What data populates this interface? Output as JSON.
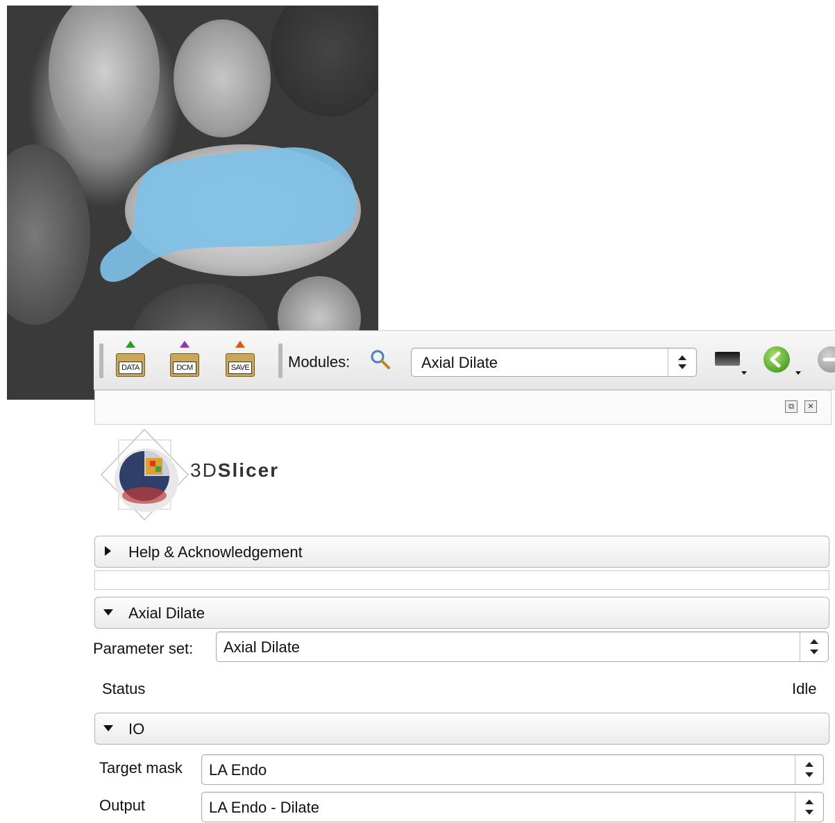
{
  "toolbar": {
    "data_label": "DATA",
    "dcm_label": "DCM",
    "save_label": "SAVE",
    "modules_label": "Modules:",
    "module_selected": "Axial Dilate"
  },
  "logo": {
    "text_prefix": "3D",
    "text_main": "Slicer"
  },
  "sections": {
    "help": "Help & Acknowledgement",
    "axial_dilate": "Axial Dilate",
    "io": "IO"
  },
  "parameter_set": {
    "label": "Parameter set:",
    "value": "Axial Dilate"
  },
  "status": {
    "label": "Status",
    "value": "Idle"
  },
  "io": {
    "target_mask_label": "Target mask",
    "target_mask_value": "LA Endo",
    "output_label": "Output",
    "output_value": "LA Endo - Dilate"
  },
  "colors": {
    "segmentation": "#7ec0e6",
    "back_arrow": "#3a9a1a"
  }
}
